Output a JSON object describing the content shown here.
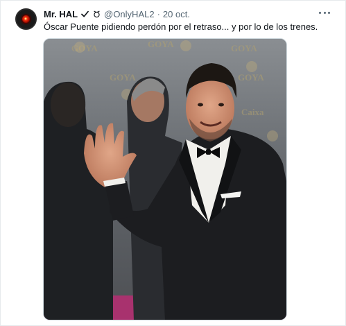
{
  "tweet": {
    "author_name": "Mr. HAL",
    "author_handle": "@OnlyHAL2",
    "separator": "·",
    "timestamp": "20 oct.",
    "text": "Óscar Puente pidiendo perdón por el retraso... y por lo de los trenes.",
    "icons": {
      "avatar": "hal-9000-eye-avatar",
      "badge_1": "verified-badge-icon",
      "badge_2": "emoji-badge-icon",
      "menu": "more-options-icon"
    }
  },
  "media": {
    "background_text": [
      "GOYA",
      "GOYA",
      "GOYA",
      "GOYA",
      "GOYA",
      "Caixa"
    ],
    "colors": {
      "backdrop": "#6b7076",
      "suit": "#1c1d20",
      "carpet": "#a8326e"
    }
  }
}
